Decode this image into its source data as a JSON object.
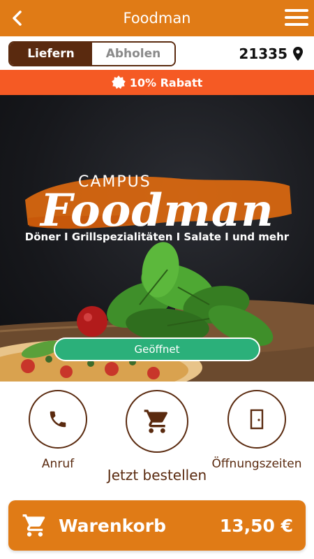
{
  "header": {
    "title": "Foodman",
    "back_icon": "chevron-left-icon",
    "menu_icon": "hamburger-menu-icon"
  },
  "mode": {
    "options": [
      "Liefern",
      "Abholen"
    ],
    "selected": "Liefern",
    "zip_code": "21335",
    "location_icon": "map-pin-icon"
  },
  "discount": {
    "icon": "badge-icon",
    "text": "10% Rabatt"
  },
  "hero": {
    "brand_small": "CAMPUS",
    "brand_big": "Foodman",
    "subtitle": "Döner I Grillspezialitäten I Salate I und mehr",
    "status": "Geöffnet"
  },
  "actions": [
    {
      "label": "Anruf",
      "icon": "phone-icon"
    },
    {
      "label": "Jetzt bestellen",
      "icon": "shopping-cart-icon"
    },
    {
      "label": "Öffnungszeiten",
      "icon": "door-icon"
    }
  ],
  "cart": {
    "label": "Warenkorb",
    "price": "13,50 €",
    "icon": "shopping-cart-icon"
  },
  "colors": {
    "brand_orange": "#e07b16",
    "discount_red": "#f55a24",
    "dark_brown": "#5a2a0f",
    "open_green": "#2bb07a"
  }
}
